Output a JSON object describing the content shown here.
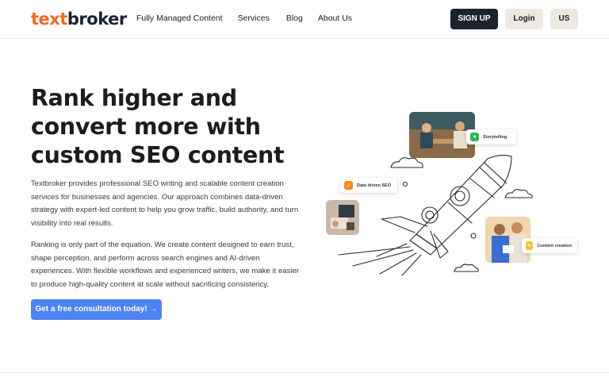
{
  "header": {
    "logo_part1": "text",
    "logo_part2": "broker",
    "nav": [
      "Fully Managed Content",
      "Services",
      "Blog",
      "About Us"
    ],
    "signup_label": "SIGN UP",
    "login_label": "Login",
    "region_label": "US"
  },
  "hero": {
    "title": "Rank higher and convert more with custom SEO content",
    "paragraph1": "Textbroker provides professional SEO writing and scalable content creation services for businesses and agencies. Our approach combines data-driven strategy with expert-led content to help you grow traffic, build authority, and turn visibility into real results.",
    "paragraph2": "Ranking is only part of the equation. We create content designed to earn trust, shape perception, and perform across search engines and AI-driven experiences. With flexible workflows and experienced writers, we make it easier to produce high-quality content at scale without sacrificing consistency.",
    "cta_label": "Get a free consultation today! →"
  },
  "illustration": {
    "chip_storytelling": "Storytelling",
    "chip_seo": "Data driven SEO",
    "chip_content": "Content creation"
  },
  "colors": {
    "brand_orange": "#f06a1e",
    "brand_dark": "#1c2433",
    "cta_blue": "#4d83f2",
    "chip_green": "#2db84d",
    "chip_orange": "#f08a24",
    "chip_yellow": "#f2c230"
  }
}
